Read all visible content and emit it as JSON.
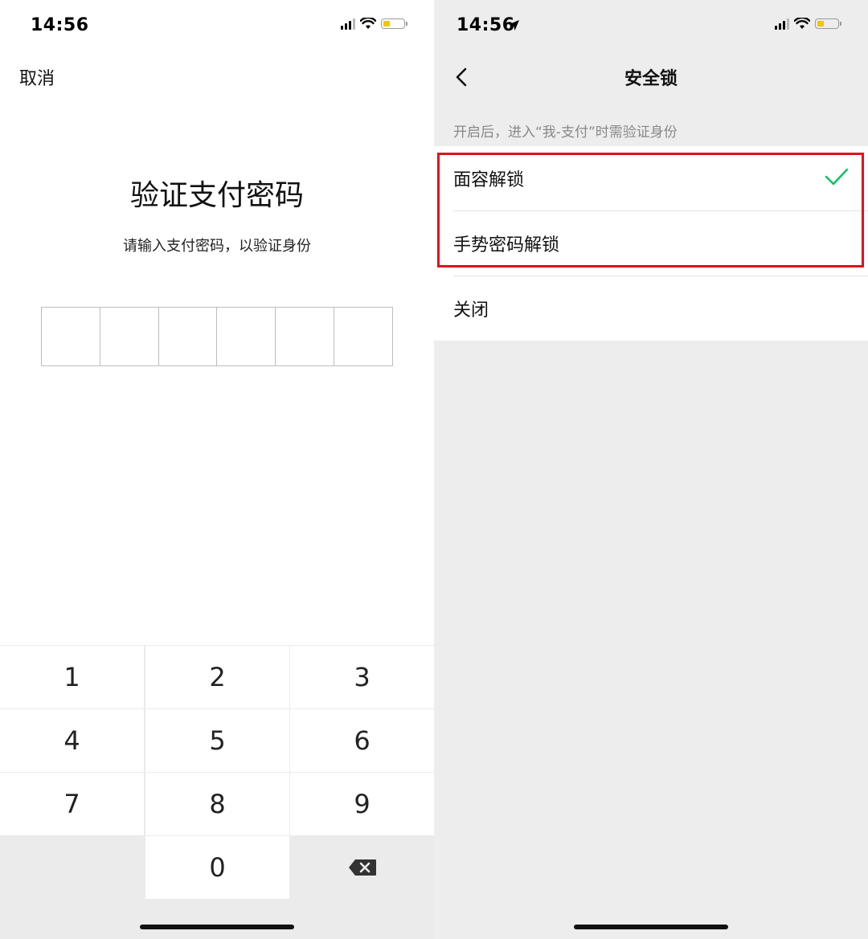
{
  "left": {
    "status_time": "14:56",
    "cancel_label": "取消",
    "title": "验证支付密码",
    "subtitle": "请输入支付密码，以验证身份",
    "pin_length": 6,
    "keys": [
      "1",
      "2",
      "3",
      "4",
      "5",
      "6",
      "7",
      "8",
      "9",
      "",
      "0",
      "⌫"
    ],
    "icons": [
      "signal-icon",
      "wifi-icon",
      "battery-icon",
      "delete-icon"
    ]
  },
  "right": {
    "status_time": "14:56",
    "nav_title": "安全锁",
    "hint": "开启后，进入“我-支付”时需验证身份",
    "options": [
      {
        "label": "面容解锁",
        "selected": true
      },
      {
        "label": "手势密码解锁",
        "selected": false
      },
      {
        "label": "关闭",
        "selected": false
      }
    ],
    "icons": [
      "location-arrow-icon",
      "signal-icon",
      "wifi-icon",
      "battery-icon",
      "back-chevron-icon",
      "checkmark-icon"
    ]
  },
  "colors": {
    "check_green": "#07c160",
    "highlight_red": "#e0121b",
    "battery_yellow": "#f5c400"
  },
  "battery_level": 0.3
}
